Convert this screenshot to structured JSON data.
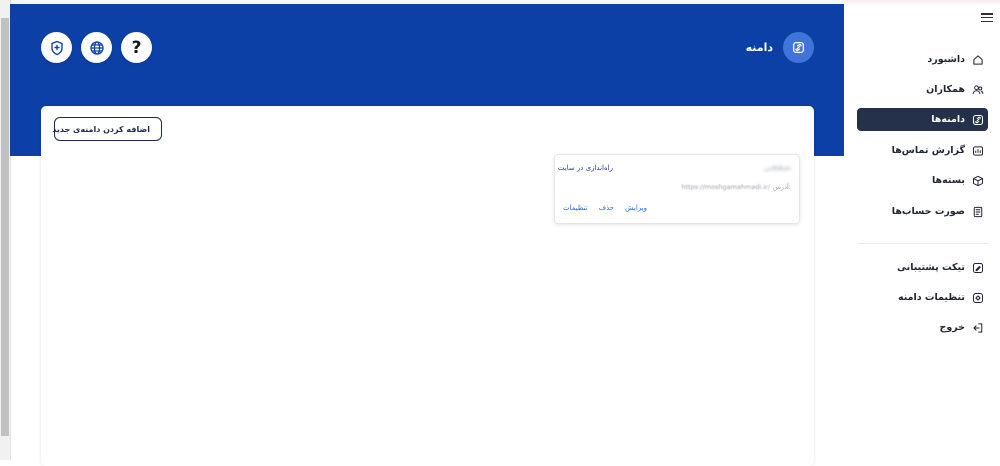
{
  "header": {
    "page_title": "دامنه",
    "help_label": "?"
  },
  "main": {
    "add_domain_label": "اضافه کردن دامنه‌ی جدید",
    "domain_card": {
      "name": "شفقی",
      "setup_label": "راه‌اندازی در سایت",
      "address_label": "آدرس:",
      "address_value": "https://moshgamahmadi.ir/",
      "actions": {
        "edit": "ویرایش",
        "delete": "حذف",
        "settings": "تنظیمات"
      }
    }
  },
  "sidebar": {
    "items": [
      {
        "label": "داشبورد",
        "icon": "home-icon"
      },
      {
        "label": "همکاران",
        "icon": "users-icon"
      },
      {
        "label": "دامنه‌ها",
        "icon": "link-icon",
        "active": true
      },
      {
        "label": "گزارش تماس‌ها",
        "icon": "report-icon"
      },
      {
        "label": "بسته‌ها",
        "icon": "package-icon"
      },
      {
        "label": "صورت حساب‌ها",
        "icon": "invoice-icon"
      }
    ],
    "bottom_items": [
      {
        "label": "تیکت پشتیبانی",
        "icon": "ticket-icon"
      },
      {
        "label": "تنظیمات دامنه",
        "icon": "domain-settings-icon"
      },
      {
        "label": "خروج",
        "icon": "logout-icon"
      }
    ]
  },
  "colors": {
    "header_blue": "#0d40a6",
    "active_nav": "#25304a",
    "link_blue": "#1a6fe0"
  }
}
